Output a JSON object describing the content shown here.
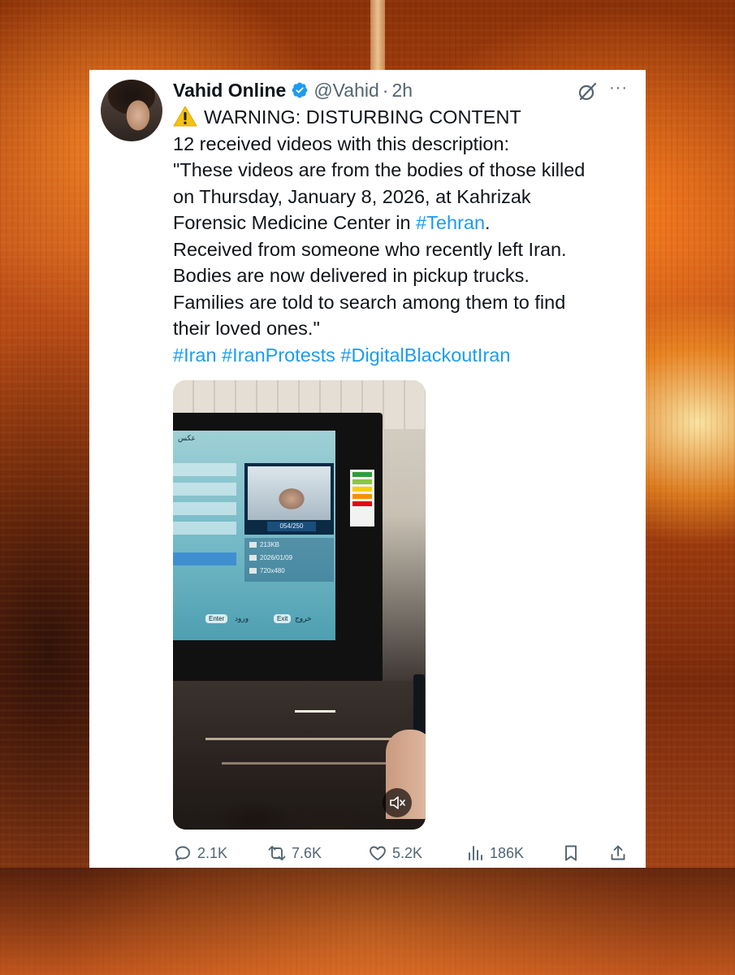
{
  "tweet": {
    "display_name": "Vahid Online",
    "handle": "@Vahid",
    "separator": "·",
    "time": "2h",
    "lines": {
      "warning": "WARNING: DISTURBING CONTENT",
      "l2": "12 received videos with this description:",
      "l3": "\"These videos are from the bodies of those killed",
      "l4": "on Thursday, January 8, 2026, at Kahrizak",
      "l5_prefix": "Forensic Medicine Center in ",
      "l5_link": "#Tehran",
      "l5_suffix": ".",
      "l6": "Received from someone who recently left Iran.",
      "l7": "Bodies are now delivered in pickup trucks.",
      "l8": "Families are told to search among them to find",
      "l9": "their loved ones.\""
    },
    "hashtags": [
      "#Iran",
      "#IranProtests",
      "#DigitalBlackoutIran"
    ],
    "media_text": {
      "tv_title": "عکس",
      "counter": "054/250",
      "size": "213KB",
      "date": "2026/01/09",
      "resolution": "720x480",
      "enter_btn": "Enter",
      "enter_label": "ورود",
      "exit_btn": "Exit",
      "exit_label": "خروج"
    },
    "stats": {
      "replies": "2.1K",
      "reposts": "7.6K",
      "likes": "5.2K",
      "views": "186K"
    },
    "icons": {
      "verified": "verified-badge-icon",
      "grok": "grok-icon",
      "more": "more-icon",
      "warning": "warning-icon",
      "mute": "muted-speaker-icon",
      "reply": "reply-icon",
      "repost": "repost-icon",
      "like": "heart-icon",
      "views": "views-icon",
      "bookmark": "bookmark-icon",
      "share": "share-icon"
    },
    "colors": {
      "link": "#1d9bf0",
      "text": "#0f1419",
      "muted": "#536471",
      "verified": "#1d9bf0",
      "warning": "#f4c20d"
    }
  }
}
